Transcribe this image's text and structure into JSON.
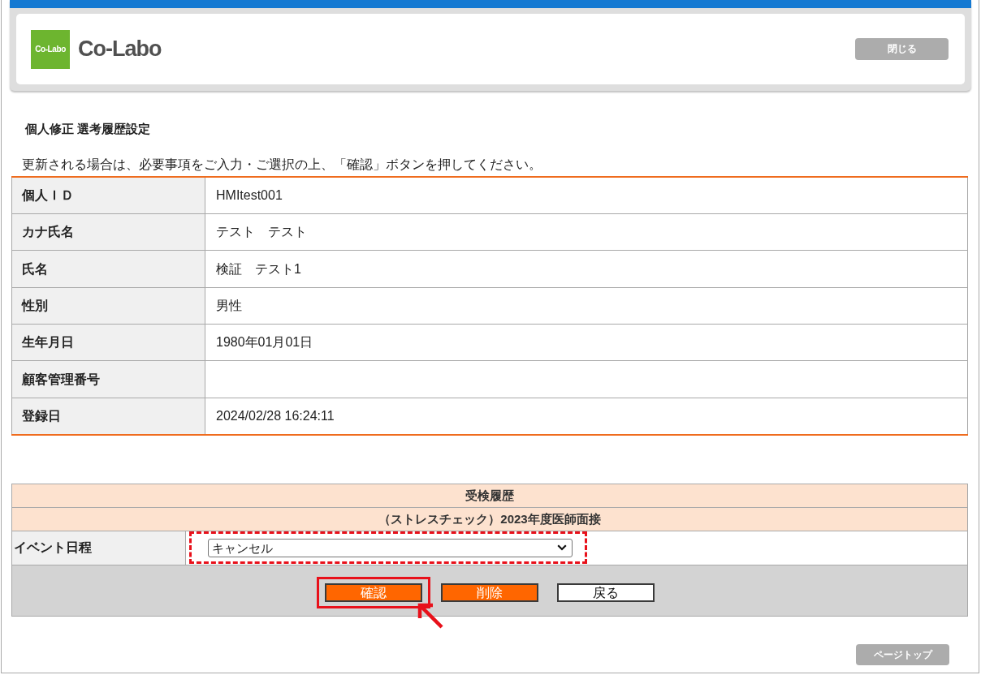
{
  "header": {
    "logo_mark": "Co-Labo",
    "logo_text": "Co-Labo",
    "close_button": "閉じる"
  },
  "page_title": "個人修正 選考履歴設定",
  "instruction": "更新される場合は、必要事項をご入力・ご選択の上、「確認」ボタンを押してください。",
  "profile_table": {
    "rows": [
      {
        "label": "個人ＩＤ",
        "value": "HMItest001"
      },
      {
        "label": "カナ氏名",
        "value": "テスト　テスト"
      },
      {
        "label": "氏名",
        "value": "検証　テスト1"
      },
      {
        "label": "性別",
        "value": "男性"
      },
      {
        "label": "生年月日",
        "value": "1980年01月01日"
      },
      {
        "label": "顧客管理番号"
      },
      {
        "label": "登録日",
        "value": "2024/02/28 16:24:11"
      }
    ]
  },
  "history": {
    "title": "受検履歴",
    "subtitle": "（ストレスチェック）2023年度医師面接",
    "field": {
      "label": "イベント日程",
      "value": "キャンセル",
      "dashed_outline": true
    }
  },
  "buttons": [
    {
      "label": "確認",
      "kind": "primary",
      "outlined": true,
      "arrow": true
    },
    {
      "label": "削除",
      "kind": "primary",
      "outlined": false,
      "arrow": false
    },
    {
      "label": "戻る",
      "kind": "plain",
      "outlined": false,
      "arrow": false
    }
  ],
  "page_top_button": "ページトップ"
}
